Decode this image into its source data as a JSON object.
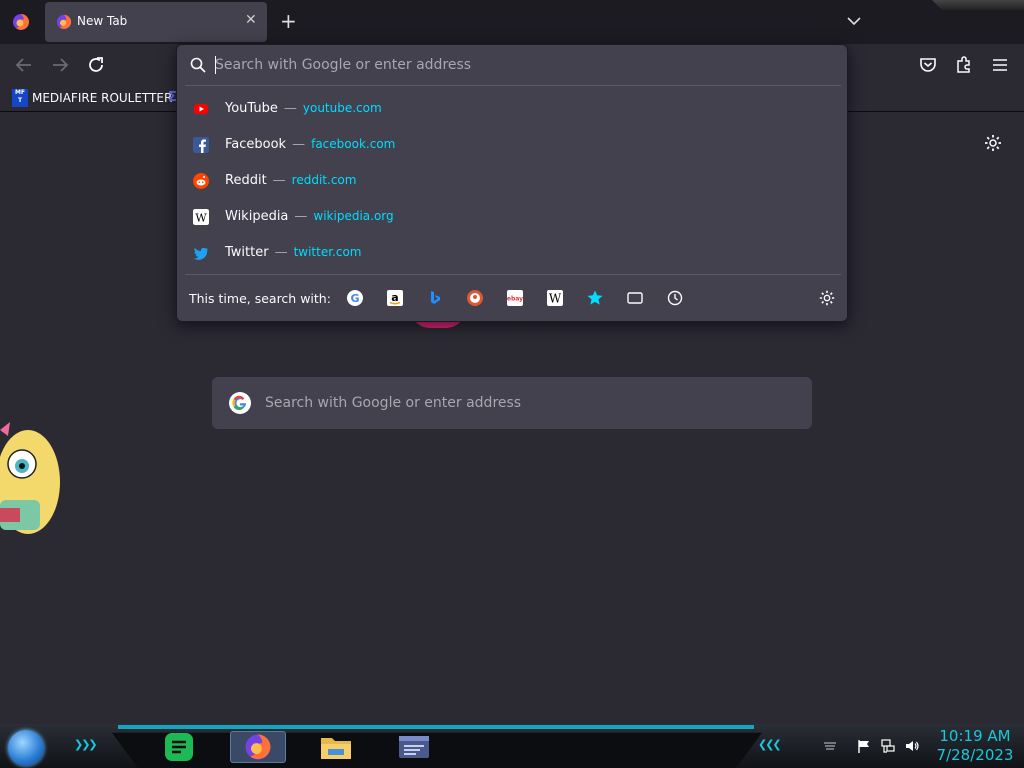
{
  "browser": {
    "tab_title": "New Tab",
    "close_tab_glyph": "✕",
    "new_tab_glyph": "+"
  },
  "bookmarks": {
    "items": [
      {
        "icon_text": "MF\nT",
        "label": "MEDIAFIRE ROULETTER"
      }
    ],
    "partial_item_glyph": "Σ"
  },
  "urlbar": {
    "placeholder": "Search with Google or enter address"
  },
  "suggestions": [
    {
      "title": "YouTube",
      "url": "youtube.com",
      "icon": "youtube-icon",
      "color": "#ff0000"
    },
    {
      "title": "Facebook",
      "url": "facebook.com",
      "icon": "facebook-icon",
      "color": "#3b5998"
    },
    {
      "title": "Reddit",
      "url": "reddit.com",
      "icon": "reddit-icon",
      "color": "#ff4500"
    },
    {
      "title": "Wikipedia",
      "url": "wikipedia.org",
      "icon": "wikipedia-icon",
      "color": "#ffffff"
    },
    {
      "title": "Twitter",
      "url": "twitter.com",
      "icon": "twitter-icon",
      "color": "#1da1f2"
    }
  ],
  "separator": "—",
  "oneoff": {
    "label": "This time, search with:",
    "engines": [
      {
        "name": "google-icon",
        "glyph": "G",
        "bg": "#ffffff",
        "fg": "#4285f4"
      },
      {
        "name": "amazon-icon",
        "glyph": "a",
        "bg": "#ffffff",
        "fg": "#000000"
      },
      {
        "name": "bing-icon",
        "glyph": "b",
        "bg": "#42414d",
        "fg": "#1e90ff"
      },
      {
        "name": "duckduckgo-icon",
        "glyph": "D",
        "bg": "#de5833",
        "fg": "#ffffff"
      },
      {
        "name": "ebay-icon",
        "glyph": "ebay",
        "bg": "#ffffff",
        "fg": "#e53238"
      },
      {
        "name": "wikipedia-icon",
        "glyph": "W",
        "bg": "#ffffff",
        "fg": "#000000"
      },
      {
        "name": "bookmarks-star-icon",
        "glyph": "★",
        "bg": "#42414d",
        "fg": "#00ddff"
      },
      {
        "name": "tabs-icon",
        "glyph": "",
        "bg": "#42414d",
        "fg": "#fbfbfe"
      },
      {
        "name": "history-icon",
        "glyph": "",
        "bg": "#42414d",
        "fg": "#fbfbfe"
      }
    ]
  },
  "newtab": {
    "search_placeholder": "Search with Google or enter address"
  },
  "taskbar": {
    "time": "10:19 AM",
    "date": "7/28/2023",
    "chevron_glyph": "❯❯❯",
    "chevron_left_glyph": "❮❮❮"
  },
  "colors": {
    "accent_link": "#00ddff",
    "panel_bg": "#42414d",
    "page_bg": "#2b2a33",
    "taskbar_accent": "#18c9dd"
  }
}
